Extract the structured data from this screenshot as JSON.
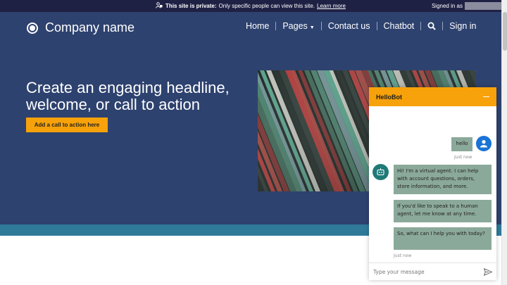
{
  "banner": {
    "private_label": "This site is private:",
    "message": "Only specific people can view this site.",
    "learn_more": "Learn more",
    "signed_in": "Signed in as"
  },
  "brand": {
    "name": "Company name"
  },
  "nav": {
    "items": [
      "Home",
      "Pages",
      "Contact us",
      "Chatbot",
      "Sign in"
    ],
    "search_icon": "search-icon"
  },
  "hero": {
    "headline": "Create an engaging headline, welcome, or call to action",
    "cta_label": "Add a call to action here",
    "image": "bookshelf-photo"
  },
  "chat": {
    "title": "HelloBot",
    "messages": [
      {
        "from": "user",
        "text": "hello",
        "time": "Just now"
      },
      {
        "from": "bot",
        "text": "Hi! I'm a virtual agent. I can help with account questions, orders, store information, and more."
      },
      {
        "from": "bot",
        "text": "If you'd like to speak to a human agent, let me know at any time."
      },
      {
        "from": "bot",
        "text": "So, what can I help you with today?",
        "time": "Just now"
      }
    ],
    "input_placeholder": "Type your message"
  },
  "colors": {
    "banner_bg": "#1f2144",
    "hero_bg": "#2e426f",
    "accent": "#f7a20a",
    "stripe": "#2f7a99",
    "bot_bubble": "#8ba99a"
  }
}
